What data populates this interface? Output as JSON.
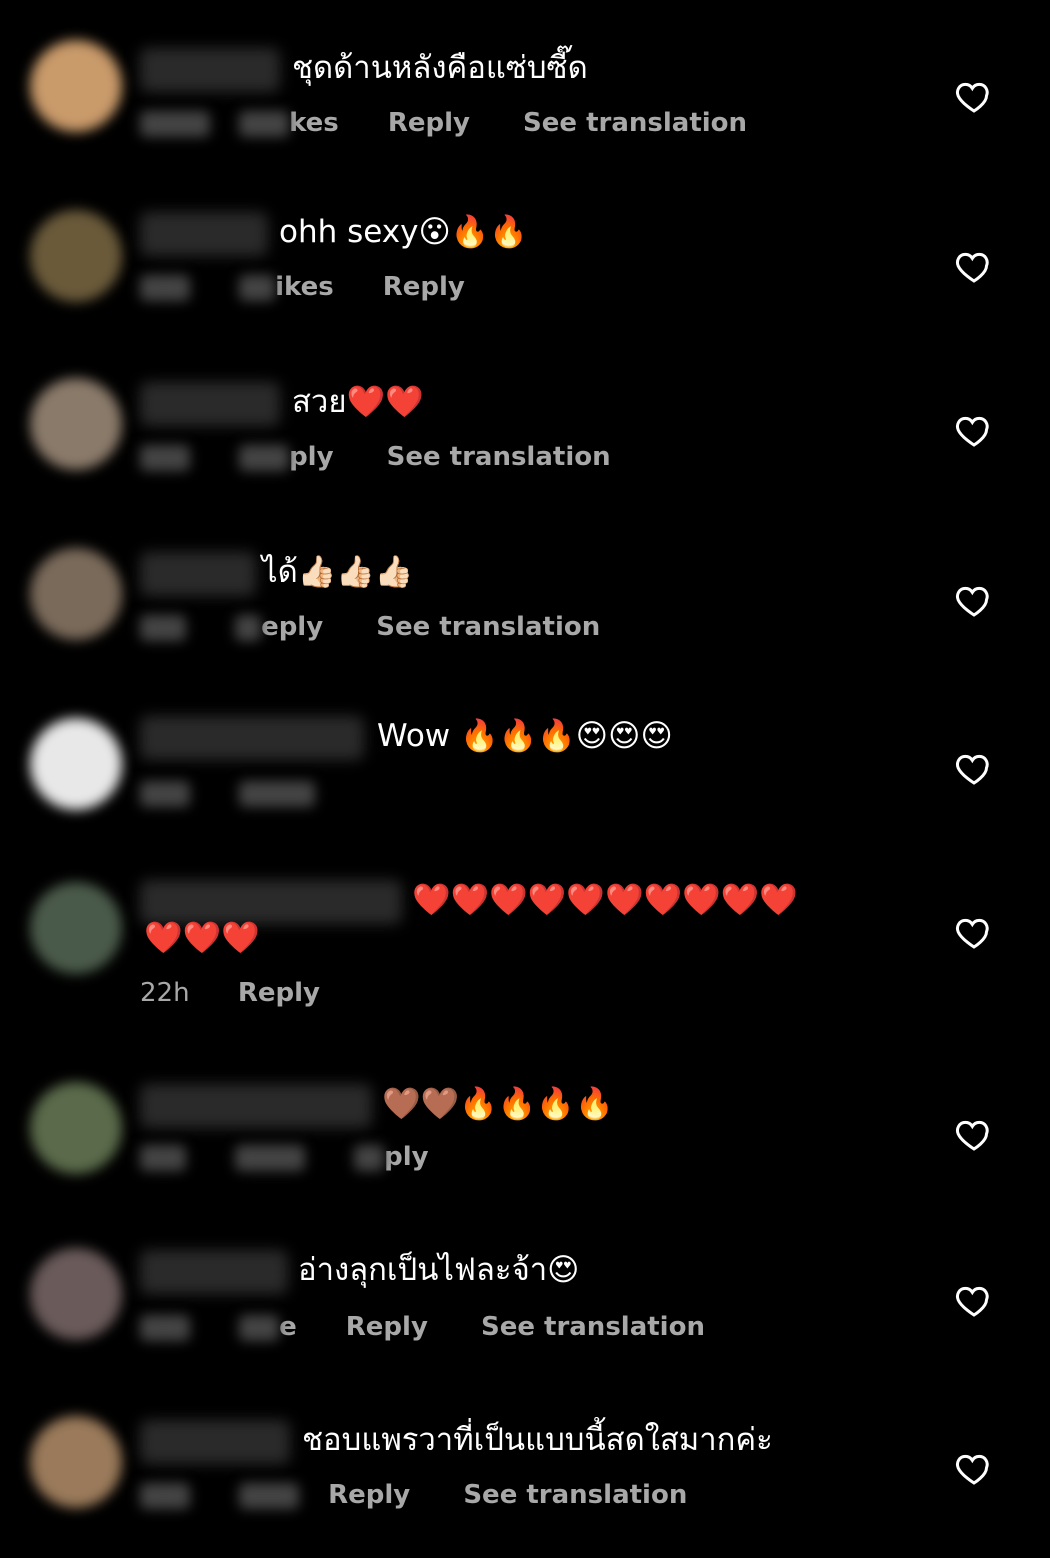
{
  "comments": [
    {
      "text": "ชุดด้านหลังคือแซ่บซี๊ด",
      "time": "",
      "likes": "kes",
      "reply": "Reply",
      "translate": "See translation",
      "avatar_color": "#c99a6a"
    },
    {
      "text": "ohh sexy😮🔥🔥",
      "likes": "ikes",
      "reply": "Reply",
      "avatar_color": "#6a5a3a"
    },
    {
      "text": "สวย❤️❤️",
      "reply": "ply",
      "translate": "See translation",
      "avatar_color": "#8a7a6a"
    },
    {
      "text": "ได้👍🏻👍🏻👍🏻",
      "reply": "eply",
      "translate": "See translation",
      "avatar_color": "#7a6a5a"
    },
    {
      "text": "Wow 🔥🔥🔥😍😍😍",
      "avatar_color": "#e8e8e8"
    },
    {
      "text_line1": "❤️❤️❤️❤️❤️❤️❤️❤️❤️❤️",
      "text_line2": "❤️❤️❤️",
      "time": "22h",
      "reply": "Reply",
      "avatar_color": "#4a5a4a"
    },
    {
      "text": "🤎🤎🔥🔥🔥🔥",
      "reply": "ply",
      "avatar_color": "#5a6a4a"
    },
    {
      "text": "อ่างลุกเป็นไฟละจ้า😍",
      "likes": "e",
      "reply": "Reply",
      "translate": "See translation",
      "avatar_color": "#6a5a5a"
    },
    {
      "text": "ชอบแพรวาที่เป็นแบบนี้สดใสมากค่ะ",
      "reply": "Reply",
      "translate": "See translation",
      "avatar_color": "#9a7a5a"
    }
  ],
  "icons": {
    "like": "heart-outline-icon"
  }
}
